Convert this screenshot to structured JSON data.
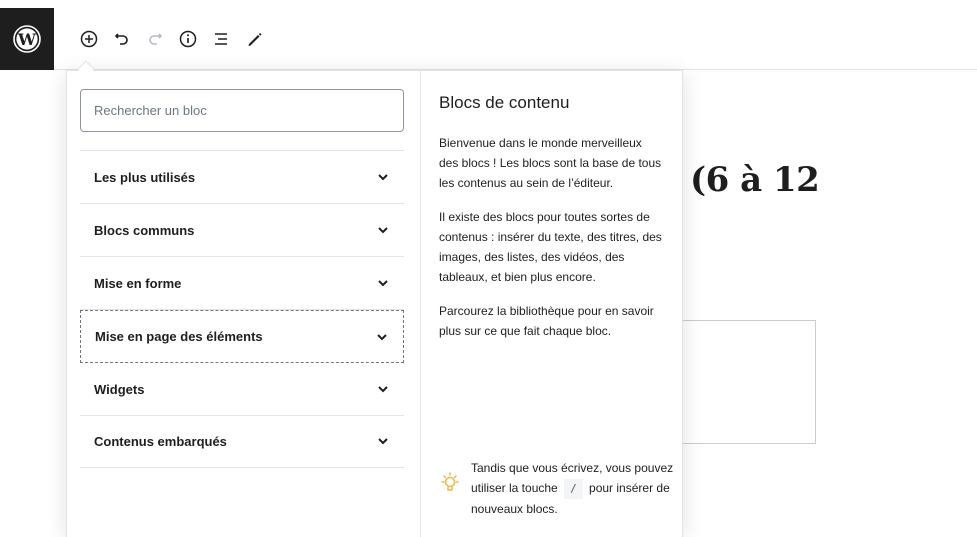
{
  "toolbar": {
    "icons": [
      "wordpress-logo",
      "add-block-icon",
      "undo-icon",
      "redo-icon",
      "info-icon",
      "list-view-icon",
      "edit-tool-icon"
    ]
  },
  "editor": {
    "heading_fragment": "(6 à 12"
  },
  "inserter": {
    "search": {
      "placeholder": "Rechercher un bloc",
      "value": ""
    },
    "panels": [
      {
        "label": "Les plus utilisés"
      },
      {
        "label": "Blocs communs"
      },
      {
        "label": "Mise en forme"
      },
      {
        "label": "Mise en page des éléments"
      },
      {
        "label": "Widgets"
      },
      {
        "label": "Contenus embarqués"
      }
    ],
    "info": {
      "title": "Blocs de contenu",
      "paragraphs": [
        "Bienvenue dans le monde merveilleux des blocs ! Les blocs sont la base de tous les contenus au sein de l’éditeur.",
        "Il existe des blocs pour toutes sortes de contenus : insérer du texte, des titres, des images, des listes, des vidéos, des tableaux, et bien plus encore.",
        "Parcourez la bibliothèque pour en savoir plus sur ce que fait chaque bloc."
      ]
    },
    "tip": {
      "before": "Tandis que vous écrivez, vous pouvez utiliser la touche",
      "key": "/",
      "after": "pour insérer de nouveaux blocs."
    }
  },
  "colors": {
    "sidebar_dark": "#1e1e1e",
    "border": "#e2e4e7",
    "tip_icon": "#f0b849"
  }
}
